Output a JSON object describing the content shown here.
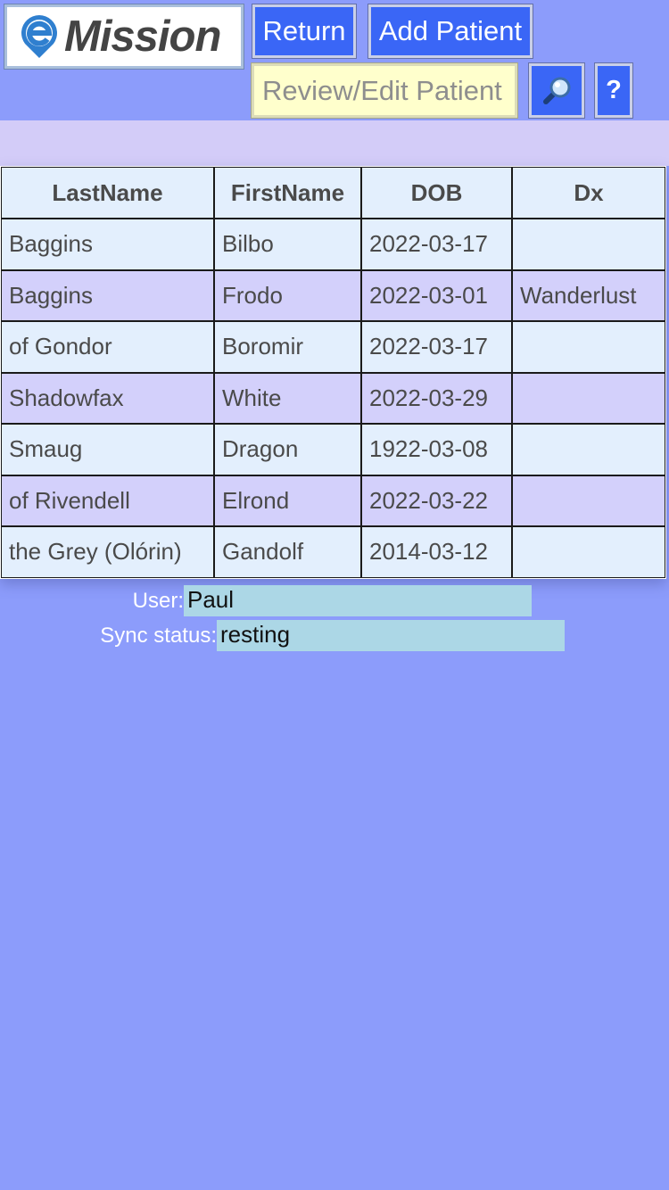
{
  "header": {
    "logo_text": "Mission",
    "return_label": "Return",
    "add_patient_label": "Add Patient",
    "review_placeholder": "Review/Edit Patient",
    "search_icon": "magnifier-icon",
    "help_label": "?"
  },
  "patients": {
    "columns": [
      "LastName",
      "FirstName",
      "DOB",
      "Dx"
    ],
    "rows": [
      {
        "last": "Baggins",
        "first": "Bilbo",
        "dob": "2022-03-17",
        "dx": ""
      },
      {
        "last": "Baggins",
        "first": "Frodo",
        "dob": "2022-03-01",
        "dx": "Wanderlust"
      },
      {
        "last": "of Gondor",
        "first": "Boromir",
        "dob": "2022-03-17",
        "dx": ""
      },
      {
        "last": "Shadowfax",
        "first": "White",
        "dob": "2022-03-29",
        "dx": ""
      },
      {
        "last": "Smaug",
        "first": "Dragon",
        "dob": "1922-03-08",
        "dx": ""
      },
      {
        "last": "of Rivendell",
        "first": "Elrond",
        "dob": "2022-03-22",
        "dx": ""
      },
      {
        "last": "the Grey (Olórin)",
        "first": "Gandolf",
        "dob": "2014-03-12",
        "dx": ""
      }
    ]
  },
  "status": {
    "user_label": "User:",
    "user_value": "Paul",
    "sync_label": "Sync status:",
    "sync_value": "resting"
  },
  "colors": {
    "background": "#8c9cfb",
    "button": "#3a66f6",
    "row_light": "#e3effd",
    "row_dark": "#d3d0fb",
    "band": "#d3ccf8",
    "status_field": "#acd7e6",
    "review_field": "#ffffcc"
  }
}
